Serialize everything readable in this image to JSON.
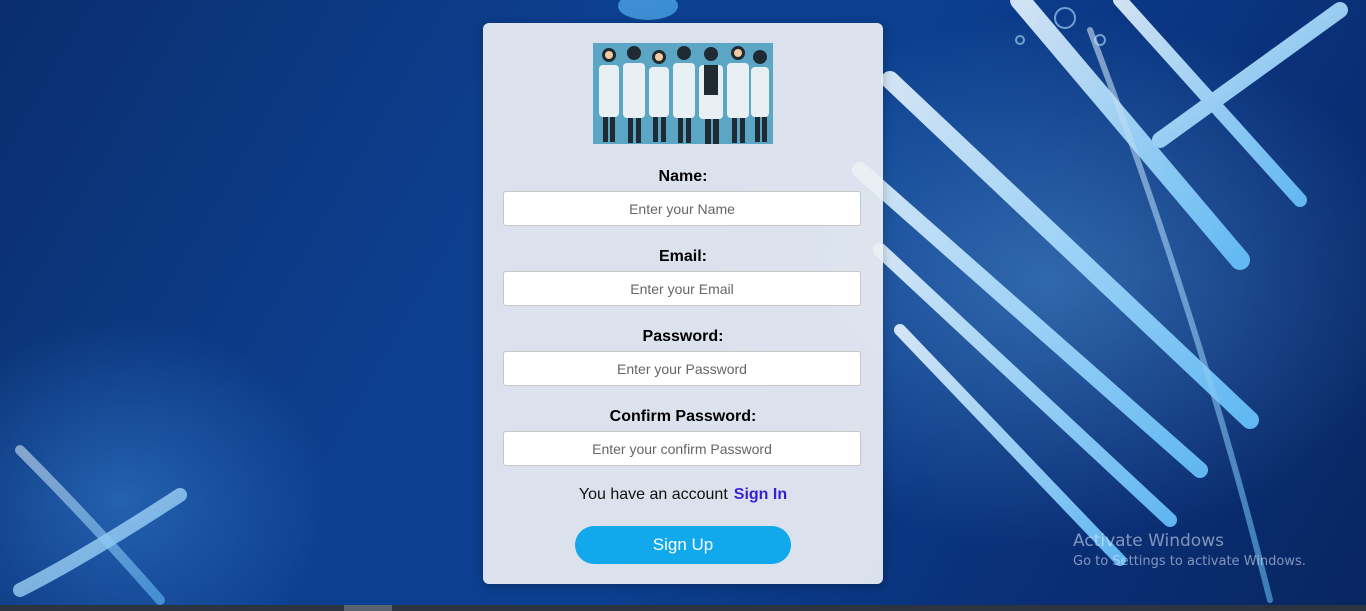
{
  "form": {
    "name_label": "Name:",
    "name_placeholder": "Enter your Name",
    "email_label": "Email:",
    "email_placeholder": "Enter your Email",
    "password_label": "Password:",
    "password_placeholder": "Enter your Password",
    "confirm_label": "Confirm Password:",
    "confirm_placeholder": "Enter your confirm Password",
    "account_text": "You have an account",
    "signin_link": "Sign In",
    "signup_button": "Sign Up"
  },
  "watermark": {
    "title": "Activate Windows",
    "subtitle": "Go to Settings to activate Windows."
  },
  "colors": {
    "background": "#0d3f8f",
    "card": "#eceff4",
    "accent_button": "#11a9ec",
    "link": "#3a1fd1"
  }
}
